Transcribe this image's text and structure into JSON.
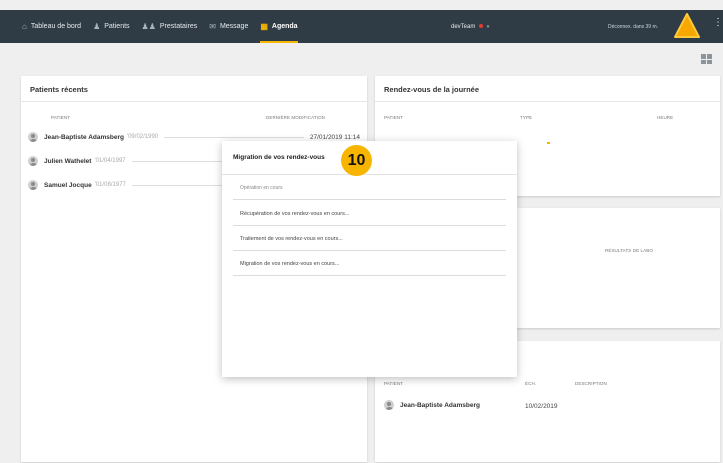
{
  "nav": {
    "items": [
      {
        "label": "Tableau de bord",
        "icon": "home-icon",
        "active": false
      },
      {
        "label": "Patients",
        "icon": "person-icon",
        "active": false
      },
      {
        "label": "Prestataires",
        "icon": "group-icon",
        "active": false
      },
      {
        "label": "Message",
        "icon": "mail-icon",
        "active": false
      },
      {
        "label": "Agenda",
        "icon": "calendar-icon",
        "active": true
      }
    ],
    "team": "devTeam",
    "logout_text": "Déconnex. dans 39 m.",
    "colors": {
      "bar": "#2f3b45",
      "accent": "#f6b700",
      "status": "#e53935"
    }
  },
  "recent": {
    "title": "Patients récents",
    "col_patient": "PATIENT",
    "col_modified": "DERNIÈRE MODIFICATION",
    "rows": [
      {
        "name": "Jean-Baptiste Adamsberg",
        "dob": "'09/02/1990",
        "modified": "27/01/2019 11:14"
      },
      {
        "name": "Julien Wathelet",
        "dob": "'01/04/1997",
        "modified": ""
      },
      {
        "name": "Samuel Jocque",
        "dob": "'01/08/1977",
        "modified": ""
      }
    ]
  },
  "rdv": {
    "title": "Rendez-vous de la journée",
    "col_patient": "PATIENT",
    "col_type": "TYPE",
    "col_time": "HEURE"
  },
  "labs": {
    "col_results": "RÉSULTATS DE LABO"
  },
  "upcoming": {
    "col_patient": "PATIENT",
    "col_date": "ÉCH.",
    "col_desc": "DESCRIPTION",
    "row": {
      "name": "Jean-Baptiste Adamsberg",
      "date": "10/02/2019"
    }
  },
  "modal": {
    "title": "Migration de vos rendez-vous",
    "badge": "10",
    "steps": [
      "Opération en cours",
      "Récupération de vos rendez-vous en cours...",
      "Traitement de vos rendez-vous en cours...",
      "Migration de vos rendez-vous en cours..."
    ]
  }
}
